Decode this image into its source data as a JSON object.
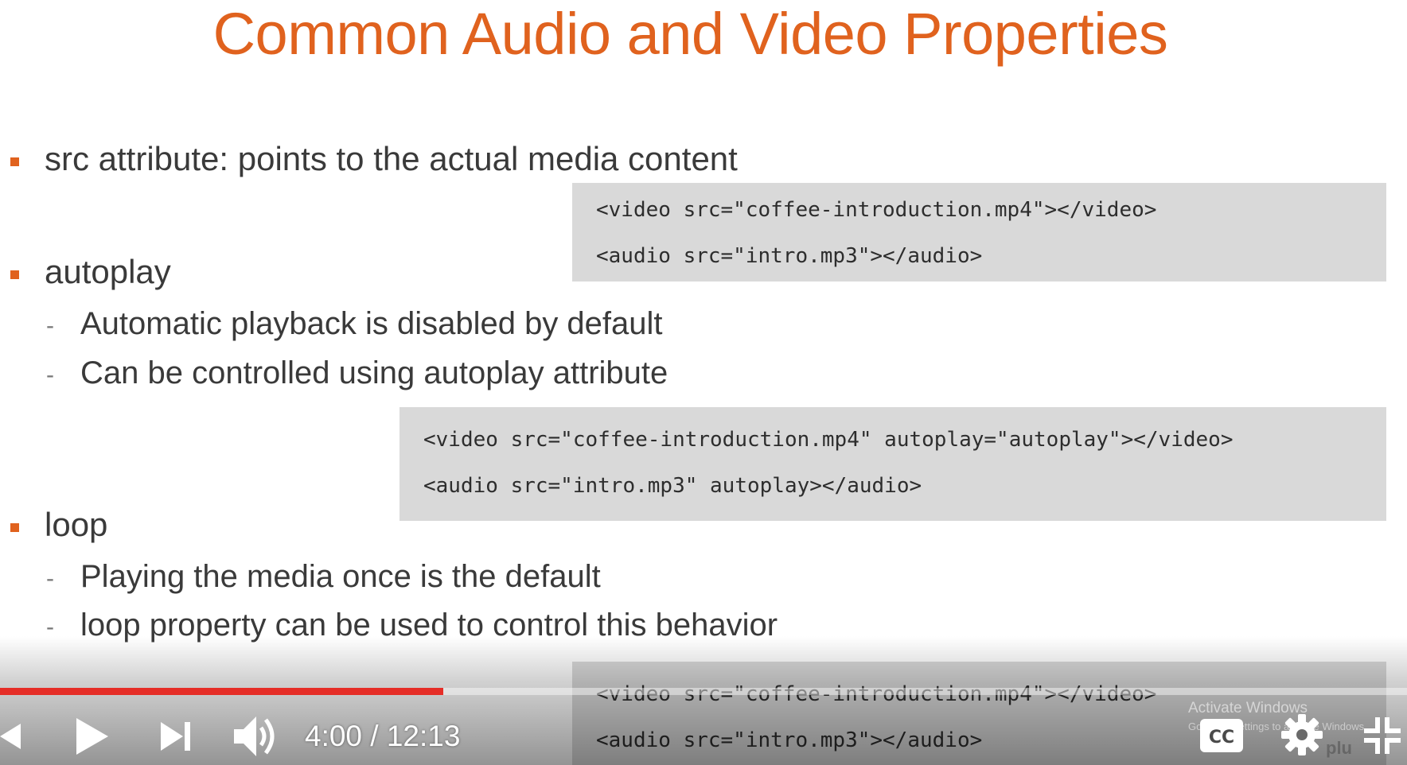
{
  "slide": {
    "title": "Common Audio and Video Properties",
    "bullets": {
      "src": "src attribute: points to the actual media content",
      "autoplay": "autoplay",
      "autoplay_subs": [
        "Automatic playback is disabled by default",
        "Can be controlled using autoplay attribute"
      ],
      "loop": "loop",
      "loop_subs": [
        "Playing the media once is the default",
        "loop property can be used to control this behavior"
      ],
      "dash": "-"
    },
    "code_blocks": [
      [
        "<video src=\"coffee-introduction.mp4\"></video>",
        "<audio src=\"intro.mp3\"></audio>"
      ],
      [
        "<video src=\"coffee-introduction.mp4\" autoplay=\"autoplay\"></video>",
        "<audio src=\"intro.mp3\" autoplay></audio>"
      ],
      [
        "<video src=\"coffee-introduction.mp4\"></video>",
        "<audio src=\"intro.mp3\"></audio>"
      ]
    ],
    "brand_partial": "plu"
  },
  "player": {
    "current_time": "4:00",
    "duration": "12:13",
    "time_display": "4:00 / 12:13",
    "progress_fraction": 0.315,
    "progress_color": "#e52d27",
    "icons": {
      "previous": "previous-icon",
      "play": "play-icon",
      "next": "next-icon",
      "volume": "volume-icon",
      "captions": "cc-icon",
      "settings": "gear-icon",
      "exit_fullscreen": "exit-fullscreen-icon"
    },
    "captions_label": "CC"
  },
  "os_watermark": {
    "line1": "Activate Windows",
    "line2": "Go to PC settings to activate Windows."
  },
  "colors": {
    "accent": "#e0621e",
    "code_bg": "#d9d9d9"
  }
}
